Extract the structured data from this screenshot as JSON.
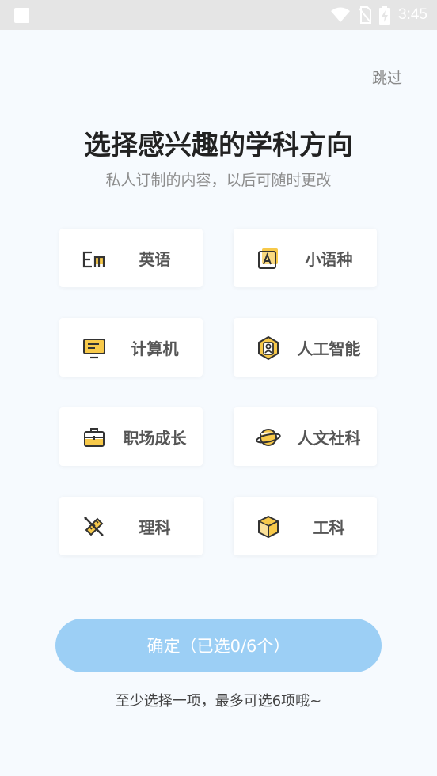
{
  "status_bar": {
    "time": "3:45",
    "icons": [
      "notification-square-icon",
      "wifi-icon",
      "no-sim-icon",
      "battery-charging-icon"
    ]
  },
  "header": {
    "skip_label": "跳过",
    "title": "选择感兴趣的学科方向",
    "subtitle": "私人订制的内容，以后可随时更改"
  },
  "subjects": [
    {
      "label": "英语",
      "icon": "english-en-icon"
    },
    {
      "label": "小语种",
      "icon": "language-a-icon"
    },
    {
      "label": "计算机",
      "icon": "monitor-icon"
    },
    {
      "label": "人工智能",
      "icon": "ai-person-hexagon-icon"
    },
    {
      "label": "职场成长",
      "icon": "briefcase-icon"
    },
    {
      "label": "人文社科",
      "icon": "planet-icon"
    },
    {
      "label": "理科",
      "icon": "ruler-pencil-icon"
    },
    {
      "label": "工科",
      "icon": "cube-icon"
    }
  ],
  "confirm_button": {
    "label": "确定（已选0/6个）"
  },
  "hint": "至少选择一项，最多可选6项哦~",
  "colors": {
    "accent_yellow": "#f7c94a",
    "button_blue": "#9ccff5",
    "background": "#f6fafe"
  }
}
